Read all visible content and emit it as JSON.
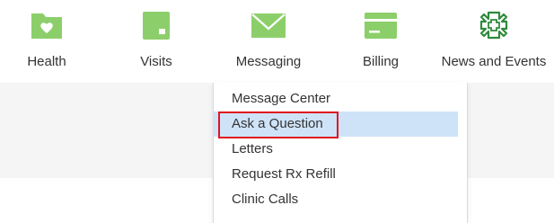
{
  "nav": {
    "items": [
      {
        "label": "Health",
        "icon": "folder-heart-icon"
      },
      {
        "label": "Visits",
        "icon": "calendar-icon"
      },
      {
        "label": "Messaging",
        "icon": "envelope-icon"
      },
      {
        "label": "Billing",
        "icon": "credit-card-icon"
      },
      {
        "label": "News and Events",
        "icon": "hospital-cross-icon"
      }
    ]
  },
  "messaging_menu": {
    "items": [
      {
        "label": "Message Center"
      },
      {
        "label": "Ask a Question",
        "highlighted": true
      },
      {
        "label": "Letters"
      },
      {
        "label": "Request Rx Refill"
      },
      {
        "label": "Clinic Calls"
      }
    ]
  },
  "colors": {
    "icon_green": "#8ccf6a",
    "highlight_blue": "#cfe3f8",
    "focus_red": "#e0141e",
    "band_gray": "#f5f5f5"
  }
}
